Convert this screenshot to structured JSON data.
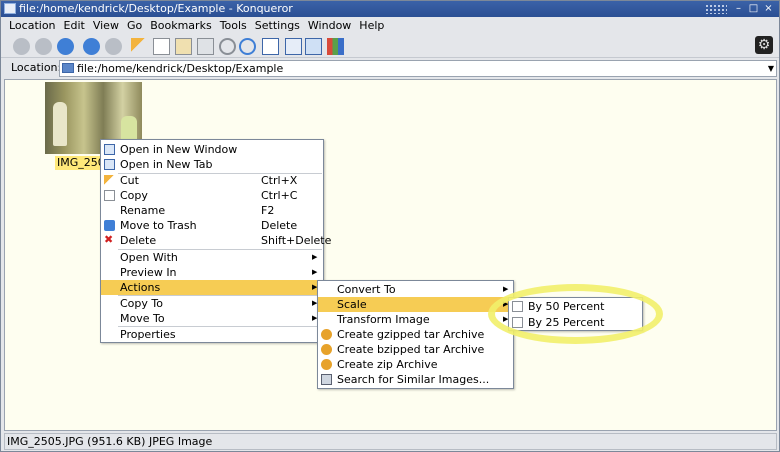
{
  "window": {
    "title": "file:/home/kendrick/Desktop/Example - Konqueror",
    "controls": [
      "–",
      "□",
      "×"
    ]
  },
  "menubar": [
    "Location",
    "Edit",
    "View",
    "Go",
    "Bookmarks",
    "Tools",
    "Settings",
    "Window",
    "Help"
  ],
  "locationbar": {
    "label": "Location:",
    "value": "file:/home/kendrick/Desktop/Example"
  },
  "file": {
    "label": "IMG_2505"
  },
  "status": {
    "text": "IMG_2505.JPG (951.6 KB)  JPEG Image"
  },
  "context_menu": {
    "items": [
      {
        "label": "Open in New Window",
        "icon": "new-window-icon"
      },
      {
        "label": "Open in New Tab",
        "icon": "new-tab-icon"
      },
      {
        "label": "Cut",
        "shortcut": "Ctrl+X",
        "icon": "scissors-icon"
      },
      {
        "label": "Copy",
        "shortcut": "Ctrl+C",
        "icon": "copy-icon"
      },
      {
        "label": "Rename",
        "shortcut": "F2"
      },
      {
        "label": "Move to Trash",
        "shortcut": "Delete",
        "icon": "trash-icon"
      },
      {
        "label": "Delete",
        "shortcut": "Shift+Delete",
        "icon": "delete-icon"
      },
      {
        "label": "Open With"
      },
      {
        "label": "Preview In"
      },
      {
        "label": "Actions"
      },
      {
        "label": "Copy To"
      },
      {
        "label": "Move To"
      },
      {
        "label": "Properties"
      }
    ]
  },
  "actions_menu": {
    "items": [
      {
        "label": "Convert To"
      },
      {
        "label": "Scale"
      },
      {
        "label": "Transform Image"
      },
      {
        "label": "Create gzipped tar Archive",
        "icon": "archive-icon"
      },
      {
        "label": "Create bzipped tar Archive",
        "icon": "archive-icon"
      },
      {
        "label": "Create zip Archive",
        "icon": "archive-icon"
      },
      {
        "label": "Search for Similar Images...",
        "icon": "image-search-icon"
      }
    ]
  },
  "scale_menu": {
    "items": [
      {
        "label": "By 50 Percent",
        "icon": "image-icon"
      },
      {
        "label": "By 25 Percent",
        "icon": "image-icon"
      }
    ]
  },
  "colors": {
    "highlight": "#f6cc54",
    "annotation_ring": "#f2f06a",
    "titlebar": "#2b4f93"
  }
}
